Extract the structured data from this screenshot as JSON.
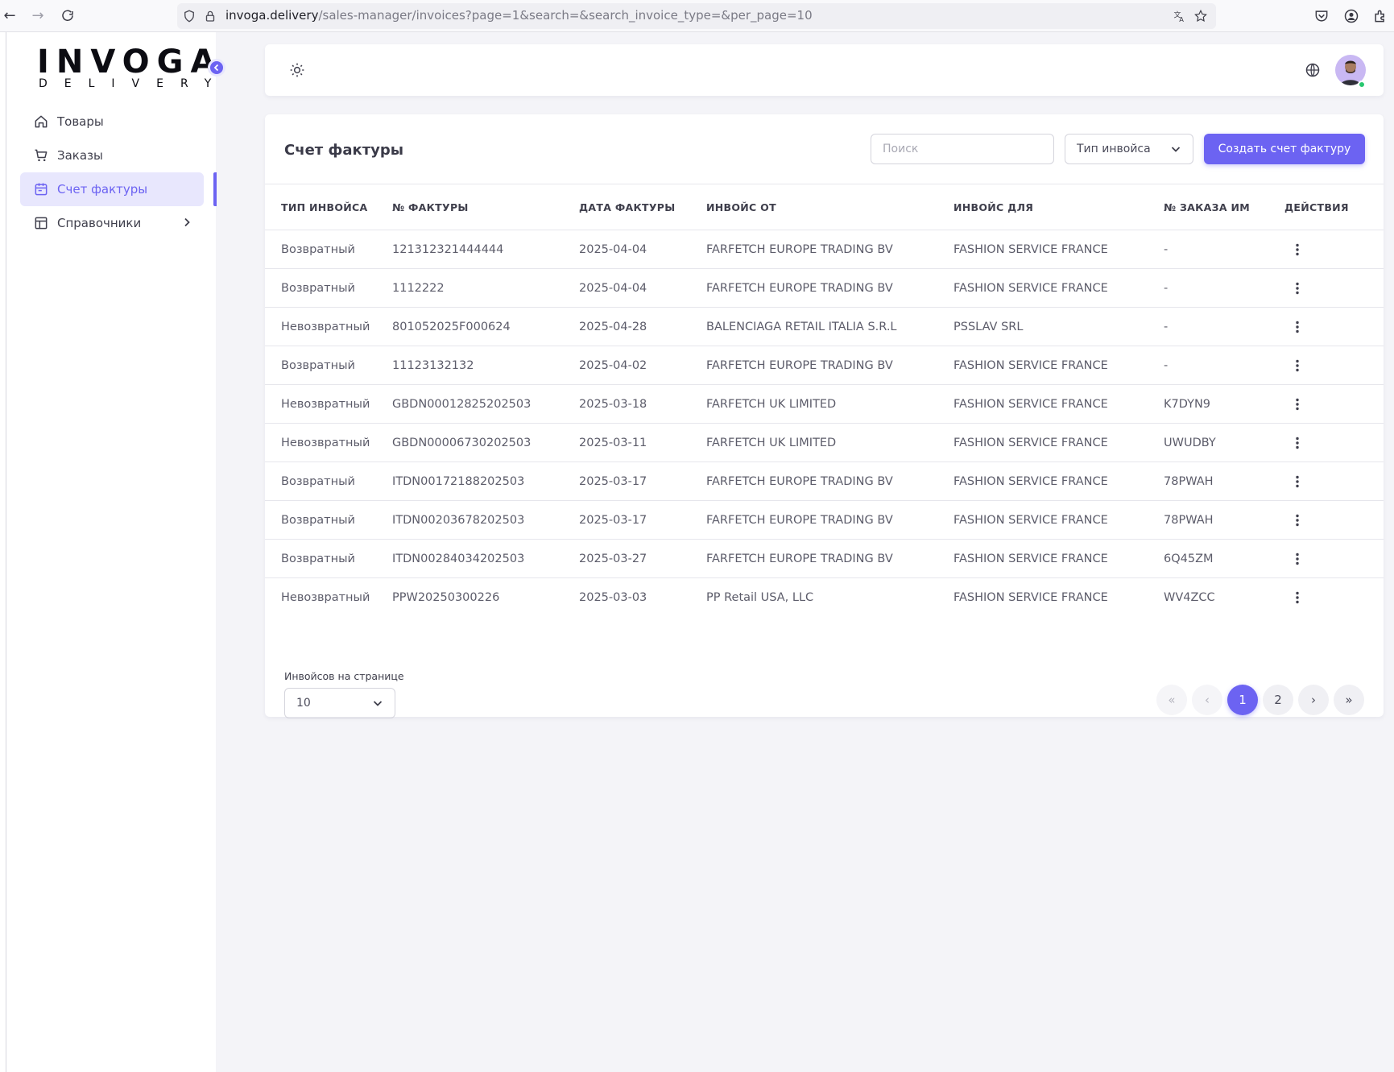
{
  "browser": {
    "url_host": "invoga.delivery",
    "url_path": "/sales-manager/invoices?page=1&search=&search_invoice_type=&per_page=10"
  },
  "brand": {
    "logo_main": "INVOGA",
    "logo_sub": "DELIVERY",
    "accent_color": "#6c63f2"
  },
  "sidebar": {
    "items": [
      {
        "label": "Товары",
        "icon": "home-icon"
      },
      {
        "label": "Заказы",
        "icon": "cart-icon"
      },
      {
        "label": "Счет фактуры",
        "icon": "calendar-icon",
        "active": true
      },
      {
        "label": "Справочники",
        "icon": "layout-icon",
        "has_submenu": true
      }
    ]
  },
  "card": {
    "title": "Счет фактуры",
    "search_placeholder": "Поиск",
    "type_select_label": "Тип инвойса",
    "create_button": "Создать счет фактуру"
  },
  "table": {
    "headers": [
      "ТИП ИНВОЙСА",
      "№ ФАКТУРЫ",
      "ДАТА ФАКТУРЫ",
      "ИНВОЙС ОТ",
      "ИНВОЙС ДЛЯ",
      "№ ЗАКАЗА ИМ",
      "ДЕЙСТВИЯ"
    ],
    "rows": [
      [
        "Возвратный",
        "121312321444444",
        "2025-04-04",
        "FARFETCH EUROPE TRADING BV",
        "FASHION SERVICE FRANCE",
        "-"
      ],
      [
        "Возвратный",
        "1112222",
        "2025-04-04",
        "FARFETCH EUROPE TRADING BV",
        "FASHION SERVICE FRANCE",
        "-"
      ],
      [
        "Невозвратный",
        "801052025F000624",
        "2025-04-28",
        "BALENCIAGA RETAIL ITALIA S.R.L",
        "PSSLAV SRL",
        "-"
      ],
      [
        "Возвратный",
        "11123132132",
        "2025-04-02",
        "FARFETCH EUROPE TRADING BV",
        "FASHION SERVICE FRANCE",
        "-"
      ],
      [
        "Невозвратный",
        "GBDN00012825202503",
        "2025-03-18",
        "FARFETCH UK LIMITED",
        "FASHION SERVICE FRANCE",
        "K7DYN9"
      ],
      [
        "Невозвратный",
        "GBDN00006730202503",
        "2025-03-11",
        "FARFETCH UK LIMITED",
        "FASHION SERVICE FRANCE",
        "UWUDBY"
      ],
      [
        "Возвратный",
        "ITDN00172188202503",
        "2025-03-17",
        "FARFETCH EUROPE TRADING BV",
        "FASHION SERVICE FRANCE",
        "78PWAH"
      ],
      [
        "Возвратный",
        "ITDN00203678202503",
        "2025-03-17",
        "FARFETCH EUROPE TRADING BV",
        "FASHION SERVICE FRANCE",
        "78PWAH"
      ],
      [
        "Возвратный",
        "ITDN00284034202503",
        "2025-03-27",
        "FARFETCH EUROPE TRADING BV",
        "FASHION SERVICE FRANCE",
        "6Q45ZM"
      ],
      [
        "Невозвратный",
        "PPW20250300226",
        "2025-03-03",
        "PP Retail USA, LLC",
        "FASHION SERVICE FRANCE",
        "WV4ZCC"
      ]
    ]
  },
  "pagination": {
    "per_page_label": "Инвойсов на странице",
    "per_page_value": "10",
    "first": "«",
    "prev": "‹",
    "pages": [
      "1",
      "2"
    ],
    "current_page": "1",
    "next": "›",
    "last": "»"
  }
}
